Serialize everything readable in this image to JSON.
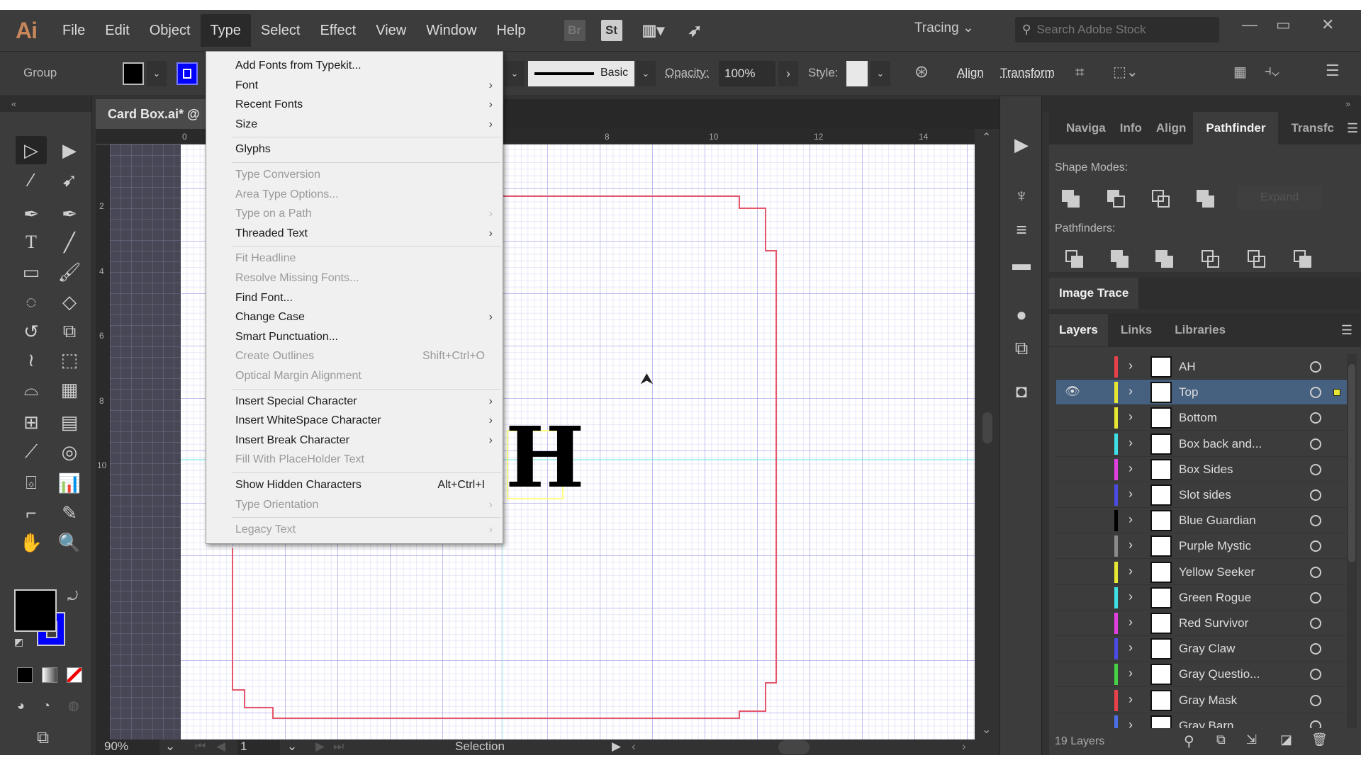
{
  "app": {
    "logo": "Ai"
  },
  "menubar": {
    "items": [
      "File",
      "Edit",
      "Object",
      "Type",
      "Select",
      "Effect",
      "View",
      "Window",
      "Help"
    ],
    "active": "Type",
    "bridge_label": "Br",
    "stock_label": "St",
    "workspace": "Tracing",
    "search_placeholder": "Search Adobe Stock"
  },
  "control": {
    "selection_type": "Group",
    "fill_color": "#000000",
    "stroke_color": "#0000ff",
    "brush_label": "Basic",
    "opacity_label": "Opacity:",
    "opacity_value": "100%",
    "style_label": "Style:",
    "align_label": "Align",
    "transform_label": "Transform"
  },
  "document": {
    "tab_title": "Card Box.ai* @",
    "ruler_h": [
      "0",
      "8",
      "10",
      "12",
      "14"
    ],
    "ruler_v": [
      "2",
      "4",
      "6",
      "8",
      "10"
    ],
    "glyph": "H"
  },
  "statusbar": {
    "zoom": "90%",
    "artboard": "1",
    "tool": "Selection"
  },
  "type_menu": {
    "items": [
      {
        "label": "Add Fonts from Typekit...",
        "enabled": true,
        "submenu": false
      },
      {
        "label": "Font",
        "enabled": true,
        "submenu": true
      },
      {
        "label": "Recent Fonts",
        "enabled": true,
        "submenu": true
      },
      {
        "label": "Size",
        "enabled": true,
        "submenu": true
      },
      {
        "sep": true
      },
      {
        "label": "Glyphs",
        "enabled": true,
        "submenu": false
      },
      {
        "sep": true
      },
      {
        "label": "Type Conversion",
        "enabled": false,
        "submenu": false
      },
      {
        "label": "Area Type Options...",
        "enabled": false,
        "submenu": false
      },
      {
        "label": "Type on a Path",
        "enabled": false,
        "submenu": true
      },
      {
        "label": "Threaded Text",
        "enabled": true,
        "submenu": true
      },
      {
        "sep": true
      },
      {
        "label": "Fit Headline",
        "enabled": false,
        "submenu": false
      },
      {
        "label": "Resolve Missing Fonts...",
        "enabled": false,
        "submenu": false
      },
      {
        "label": "Find Font...",
        "enabled": true,
        "submenu": false
      },
      {
        "label": "Change Case",
        "enabled": true,
        "submenu": true
      },
      {
        "label": "Smart Punctuation...",
        "enabled": true,
        "submenu": false
      },
      {
        "label": "Create Outlines",
        "enabled": false,
        "submenu": false,
        "shortcut": "Shift+Ctrl+O"
      },
      {
        "label": "Optical Margin Alignment",
        "enabled": false,
        "submenu": false
      },
      {
        "sep": true
      },
      {
        "label": "Insert Special Character",
        "enabled": true,
        "submenu": true
      },
      {
        "label": "Insert WhiteSpace Character",
        "enabled": true,
        "submenu": true
      },
      {
        "label": "Insert Break Character",
        "enabled": true,
        "submenu": true
      },
      {
        "label": "Fill With PlaceHolder Text",
        "enabled": false,
        "submenu": false
      },
      {
        "sep": true
      },
      {
        "label": "Show Hidden Characters",
        "enabled": true,
        "submenu": false,
        "shortcut": "Alt+Ctrl+I"
      },
      {
        "label": "Type Orientation",
        "enabled": false,
        "submenu": true
      },
      {
        "sep": true
      },
      {
        "label": "Legacy Text",
        "enabled": false,
        "submenu": true
      }
    ]
  },
  "panels": {
    "top_tabs": [
      "Naviga",
      "Info",
      "Align",
      "Pathfinder",
      "Transfc"
    ],
    "top_active": "Pathfinder",
    "shape_modes_label": "Shape Modes:",
    "expand_label": "Expand",
    "pathfinders_label": "Pathfinders:",
    "image_trace_tab": "Image Trace",
    "layer_tabs": [
      "Layers",
      "Links",
      "Libraries"
    ],
    "layer_active": "Layers",
    "layers": [
      {
        "name": "AH",
        "color": "#e8414b",
        "visible": false,
        "selected": false
      },
      {
        "name": "Top",
        "color": "#e6e633",
        "visible": true,
        "selected": true
      },
      {
        "name": "Bottom",
        "color": "#e6e633",
        "visible": false,
        "selected": false
      },
      {
        "name": "Box back and...",
        "color": "#3ee0e6",
        "visible": false,
        "selected": false
      },
      {
        "name": "Box Sides",
        "color": "#e040e0",
        "visible": false,
        "selected": false
      },
      {
        "name": "Slot sides",
        "color": "#4b4be6",
        "visible": false,
        "selected": false
      },
      {
        "name": "Blue Guardian",
        "color": "#000000",
        "visible": false,
        "selected": false
      },
      {
        "name": "Purple Mystic",
        "color": "#8a8a8a",
        "visible": false,
        "selected": false
      },
      {
        "name": "Yellow Seeker",
        "color": "#e6e633",
        "visible": false,
        "selected": false
      },
      {
        "name": "Green Rogue",
        "color": "#3ee0e6",
        "visible": false,
        "selected": false
      },
      {
        "name": "Red Survivor",
        "color": "#e040e0",
        "visible": false,
        "selected": false
      },
      {
        "name": "Gray Claw",
        "color": "#4b4be6",
        "visible": false,
        "selected": false
      },
      {
        "name": "Gray Questio...",
        "color": "#45d245",
        "visible": false,
        "selected": false
      },
      {
        "name": "Gray Mask",
        "color": "#e8414b",
        "visible": false,
        "selected": false
      },
      {
        "name": "Gray Barn",
        "color": "#4a6fe6",
        "visible": false,
        "selected": false
      }
    ],
    "layer_count": "19 Layers"
  }
}
